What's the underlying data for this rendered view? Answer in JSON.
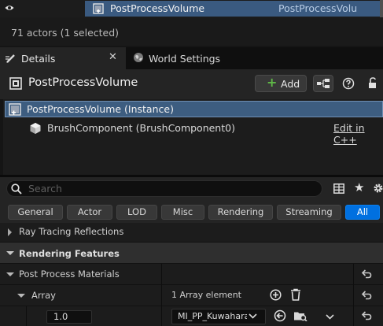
{
  "outliner": {
    "selected_name": "PostProcessVolume",
    "selected_type": "PostProcessVolu"
  },
  "status": {
    "actor_count": "71 actors (1 selected)"
  },
  "tabs": [
    {
      "label": "Details"
    },
    {
      "label": "World Settings"
    }
  ],
  "details": {
    "title": "PostProcessVolume",
    "add_label": "Add",
    "instance_label": "PostProcessVolume (Instance)",
    "component_label": "BrushComponent (BrushComponent0)",
    "edit_link": "Edit in C++"
  },
  "search": {
    "placeholder": "Search"
  },
  "filters": [
    "General",
    "Actor",
    "LOD",
    "Misc",
    "Rendering",
    "Streaming",
    "All"
  ],
  "active_filter": "All",
  "properties": {
    "ray_tracing": "Ray Tracing Reflections",
    "rendering_features": "Rendering Features",
    "pp_materials": "Post Process Materials",
    "array_label": "Array",
    "array_count": "1 Array element",
    "element_weight": "1.0",
    "element_asset": "MI_PP_Kuwahara"
  },
  "colors": {
    "selection": "#3a5a80",
    "accent": "#0070e0",
    "add_plus": "#5fb847"
  }
}
